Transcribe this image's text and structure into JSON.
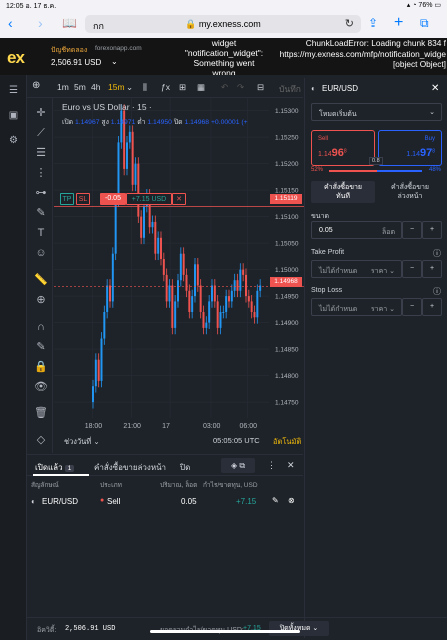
{
  "ios": {
    "time": "12:05",
    "date": "อ. 17 ธ.ค.",
    "battery": "76%"
  },
  "browser": {
    "tab_label": "กก",
    "host": "my.exness.com"
  },
  "account": {
    "type": "ปัญชีทดลอง",
    "server": "forexonapp.com",
    "balance": "2,506.91 USD"
  },
  "errors": {
    "left": "widget\n\"notification_widget\":\nSomething went\nwrong",
    "right": "ChunkLoadError: Loading chunk 834 f\nhttps://my.exness.com/mfp/notification_widge\n[object Object]"
  },
  "chart_toolbar": {
    "t1": "1m",
    "t2": "5m",
    "t3": "4h",
    "t4": "15m",
    "save": "บันทึก"
  },
  "chart_header": {
    "symbol_title": "Euro vs US Dollar · 15 ·",
    "open_label": "เปิด",
    "open": "1.14967",
    "high_label": "สูง",
    "high": "1.14971",
    "low_label": "ต่ำ",
    "low": "1.14950",
    "close_label": "ปิด",
    "close": "1.14968",
    "change": "+0.00001 (+"
  },
  "trade_line": {
    "tp": "TP",
    "sl": "SL",
    "qty": "-0.05",
    "pnl": "+7.15 USD",
    "close": "✕",
    "price_tag": "1.15119"
  },
  "current_price_tag": "1.14968",
  "chart_data": {
    "type": "candlestick",
    "title": "Euro vs US Dollar · 15",
    "xlabel": "",
    "ylabel": "",
    "x_ticks": [
      "18:00",
      "21:00",
      "17",
      "03:00",
      "06:00"
    ],
    "y_ticks": [
      "1.15300",
      "1.15250",
      "1.15200",
      "1.15150",
      "1.15100",
      "1.15050",
      "1.15000",
      "1.14950",
      "1.14900",
      "1.14850",
      "1.14800",
      "1.14750"
    ],
    "ylim": [
      1.1472,
      1.1532
    ],
    "closes": [
      1.1478,
      1.1483,
      1.1479,
      1.1487,
      1.1492,
      1.1497,
      1.1494,
      1.1503,
      1.1513,
      1.1524,
      1.153,
      1.1519,
      1.1524,
      1.1526,
      1.1516,
      1.152,
      1.151,
      1.1506,
      1.1512,
      1.1514,
      1.1508,
      1.1509,
      1.1503,
      1.1506,
      1.1502,
      1.1499,
      1.1494,
      1.1497,
      1.1489,
      1.1494,
      1.1498,
      1.1503,
      1.1499,
      1.1496,
      1.1492,
      1.1495,
      1.1501,
      1.1497,
      1.1492,
      1.1489,
      1.149,
      1.1494,
      1.1497,
      1.1494,
      1.1489,
      1.1492,
      1.1492,
      1.1495,
      1.1494,
      1.1496,
      1.1498,
      1.1496,
      1.15,
      1.1499,
      1.1495,
      1.1494,
      1.1492,
      1.1491,
      1.1496,
      1.1497
    ],
    "bull_color": "#2196f3",
    "bear_color": "#ef5350"
  },
  "chart_footer": {
    "range": "ช่วงวันที่",
    "clock": "05:05:05 UTC",
    "auto": "อัตโนมัติ"
  },
  "order": {
    "symbol": "EUR/USD",
    "mode": "โหมดเริ่มต้น",
    "sell_label": "Sell",
    "sell_price_a": "1.14",
    "sell_price_b": "96",
    "sell_price_c": "8",
    "buy_label": "Buy",
    "buy_price_a": "1.14",
    "buy_price_b": "97",
    "buy_price_c": "8",
    "spread": "0.8",
    "sell_pct": "52%",
    "buy_pct": "48%",
    "tab_market": "คำสั่งซื้อขาย\nทันที",
    "tab_pending": "คำสั่งซื้อขาย\nล่วงหน้า",
    "volume_label": "ขนาด",
    "volume": "0.05",
    "volume_unit": "ล็อต",
    "tp_label": "Take Profit",
    "tp_value": "ไม่ได้กำหนด",
    "tp_unit": "ราคา",
    "sl_label": "Stop Loss",
    "sl_value": "ไม่ได้กำหนด",
    "sl_unit": "ราคา"
  },
  "positions": {
    "tab_open": "เปิดแล้ว",
    "open_count": "1",
    "tab_pending": "คำสั่งซื้อขายล่วงหน้า",
    "tab_closed": "ปิด",
    "col_symbol": "สัญลักษณ์",
    "col_type": "ประเภท",
    "col_volume": "ปริมาณ, ล็อต",
    "col_pnl": "กำไร/ขาดทุน, USD",
    "rows": [
      {
        "symbol": "EUR/USD",
        "type": "Sell",
        "volume": "0.05",
        "pnl": "+7.15"
      }
    ]
  },
  "footer": {
    "equity_label": "อิควิตี้:",
    "equity": "2,506.91 USD",
    "pnl_label": "ยอดรวมกำไร/ขาดทุน USD:",
    "pnl": "+7.15",
    "close_all": "ปิดทั้งหมด"
  }
}
